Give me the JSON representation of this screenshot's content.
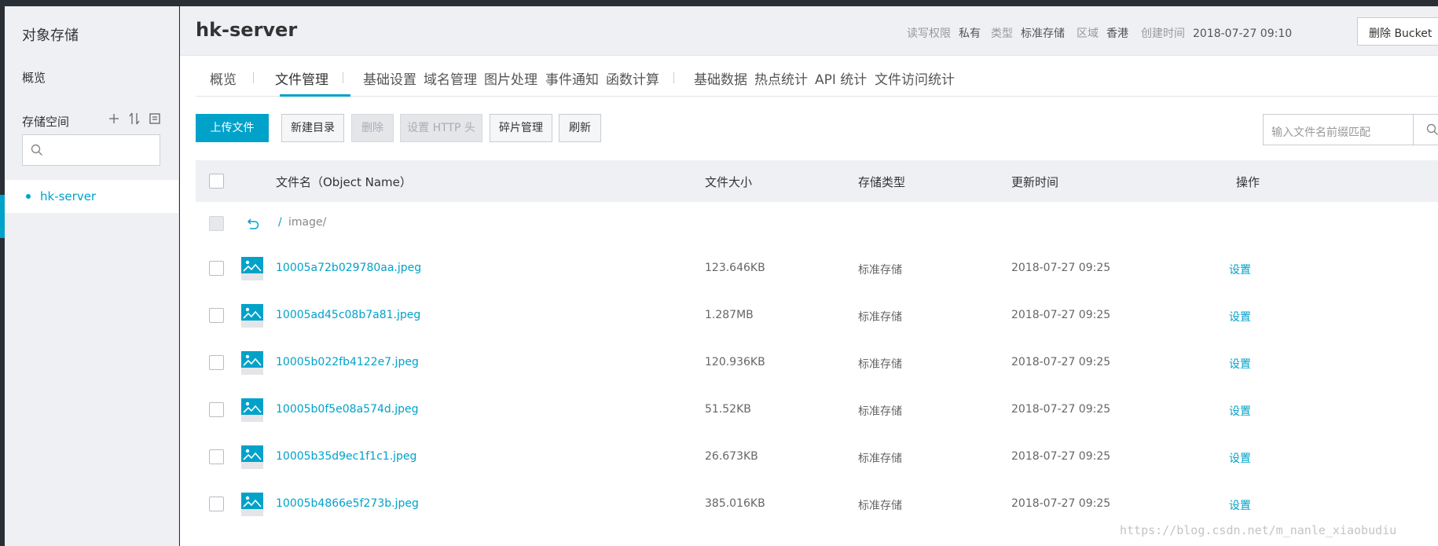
{
  "sidebar": {
    "title": "对象存储",
    "overview": "概览",
    "space_label": "存储空间",
    "bucket_name": "hk-server"
  },
  "header": {
    "bucket_title": "hk-server",
    "permission_label": "读写权限",
    "permission_value": "私有",
    "type_label": "类型",
    "type_value": "标准存储",
    "region_label": "区域",
    "region_value": "香港",
    "created_label": "创建时间",
    "created_value": "2018-07-27 09:10",
    "delete_bucket": "删除 Bucket"
  },
  "tabs": [
    "概览",
    "文件管理",
    "基础设置",
    "域名管理",
    "图片处理",
    "事件通知",
    "函数计算",
    "基础数据",
    "热点统计",
    "API 统计",
    "文件访问统计"
  ],
  "active_tab_index": 1,
  "toolbar": {
    "upload": "上传文件",
    "new_dir": "新建目录",
    "delete": "删除",
    "set_http": "设置 HTTP 头",
    "fragments": "碎片管理",
    "refresh": "刷新"
  },
  "search": {
    "placeholder": "输入文件名前缀匹配"
  },
  "table": {
    "headers": {
      "name": "文件名（Object Name）",
      "size": "文件大小",
      "storage": "存储类型",
      "updated": "更新时间",
      "actions": "操作"
    },
    "path_sep": "/",
    "path": "image/",
    "rows": [
      {
        "name": "10005a72b029780aa.jpeg",
        "size": "123.646KB",
        "storage": "标准存储",
        "updated": "2018-07-27 09:25",
        "action": "设置"
      },
      {
        "name": "10005ad45c08b7a81.jpeg",
        "size": "1.287MB",
        "storage": "标准存储",
        "updated": "2018-07-27 09:25",
        "action": "设置"
      },
      {
        "name": "10005b022fb4122e7.jpeg",
        "size": "120.936KB",
        "storage": "标准存储",
        "updated": "2018-07-27 09:25",
        "action": "设置"
      },
      {
        "name": "10005b0f5e08a574d.jpeg",
        "size": "51.52KB",
        "storage": "标准存储",
        "updated": "2018-07-27 09:25",
        "action": "设置"
      },
      {
        "name": "10005b35d9ec1f1c1.jpeg",
        "size": "26.673KB",
        "storage": "标准存储",
        "updated": "2018-07-27 09:25",
        "action": "设置"
      },
      {
        "name": "10005b4866e5f273b.jpeg",
        "size": "385.016KB",
        "storage": "标准存储",
        "updated": "2018-07-27 09:25",
        "action": "设置"
      }
    ]
  },
  "watermark": "https://blog.csdn.net/m_nanle_xiaobudiu",
  "colors": {
    "accent": "#00a2ca",
    "sidebar_bg": "#eef0f3",
    "frame": "#2a2e35"
  }
}
